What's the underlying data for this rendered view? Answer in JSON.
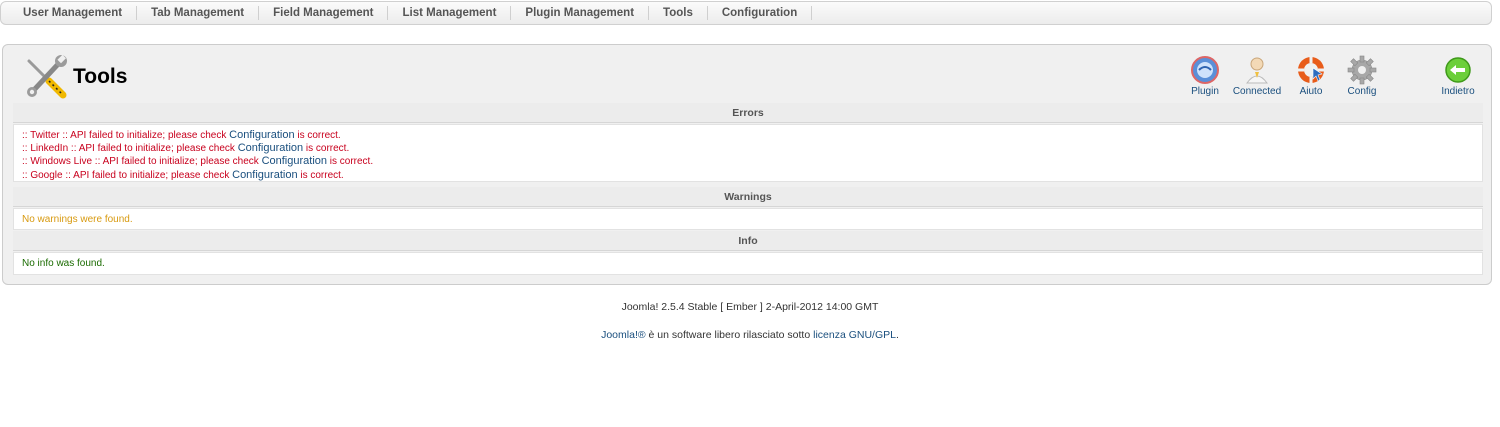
{
  "nav": {
    "items": [
      {
        "label": "User Management"
      },
      {
        "label": "Tab Management"
      },
      {
        "label": "Field Management"
      },
      {
        "label": "List Management"
      },
      {
        "label": "Plugin Management"
      },
      {
        "label": "Tools"
      },
      {
        "label": "Configuration"
      }
    ]
  },
  "header": {
    "title": "Tools",
    "icon": "tools-wrench-screwdriver-icon"
  },
  "toolbar": {
    "plugin_label": "Plugin",
    "connected_label": "Connected",
    "aiuto_label": "Aiuto",
    "config_label": "Config",
    "indietro_label": "Indietro"
  },
  "errors": {
    "heading": "Errors",
    "items": [
      {
        "prefix": ":: Twitter :: API failed to initialize; please check ",
        "link": "Configuration",
        "suffix": " is correct."
      },
      {
        "prefix": ":: LinkedIn :: API failed to initialize; please check ",
        "link": "Configuration",
        "suffix": " is correct."
      },
      {
        "prefix": ":: Windows Live :: API failed to initialize; please check ",
        "link": "Configuration",
        "suffix": " is correct."
      },
      {
        "prefix": ":: Google :: API failed to initialize; please check ",
        "link": "Configuration",
        "suffix": " is correct."
      }
    ]
  },
  "warnings": {
    "heading": "Warnings",
    "message": "No warnings were found."
  },
  "info": {
    "heading": "Info",
    "message": "No info was found."
  },
  "footer": {
    "version": "Joomla! 2.5.4 Stable [ Ember ] 2-April-2012 14:00 GMT",
    "joomla_link": "Joomla!®",
    "license_text": " è un software libero rilasciato sotto ",
    "license_link": "licenza GNU/GPL",
    "license_end": "."
  },
  "colors": {
    "error": "#c8001d",
    "warning": "#d89a10",
    "info": "#1a6b00",
    "link": "#1a4f7e"
  }
}
